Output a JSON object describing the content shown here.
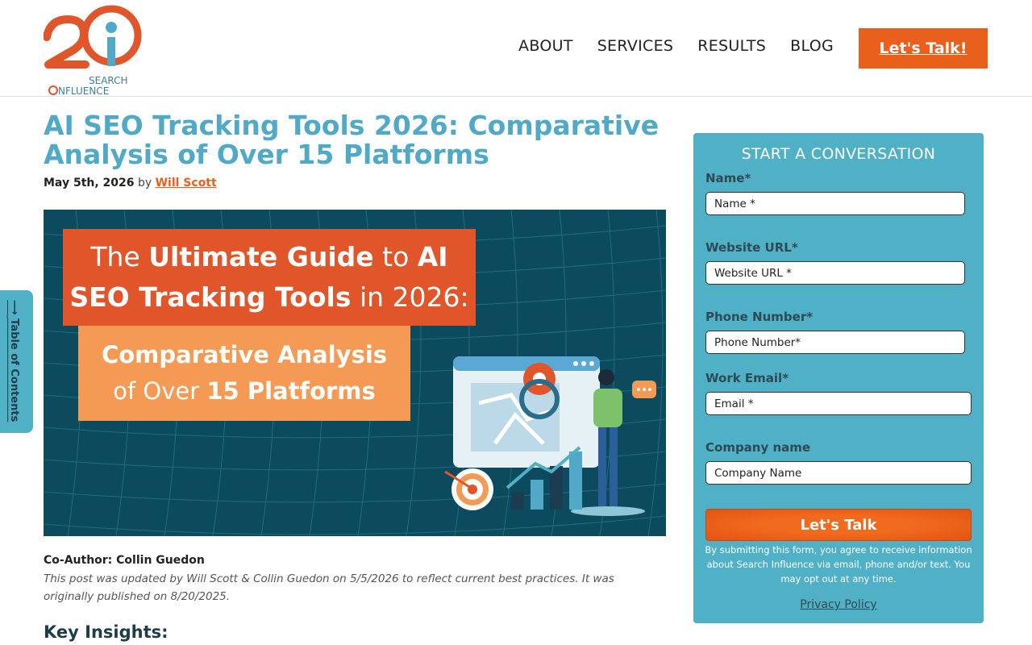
{
  "brand": {
    "logo_line1": "SEARCH",
    "logo_line2": "NFLUENCE"
  },
  "nav": {
    "items": [
      "ABOUT",
      "SERVICES",
      "RESULTS",
      "BLOG"
    ],
    "cta": "Let's Talk!"
  },
  "article": {
    "title": "AI SEO Tracking Tools 2026: Comparative Analysis of Over 15 Platforms",
    "date": "May 5th, 2026",
    "by": "by",
    "author": "Will Scott",
    "hero": {
      "line1_plain": "The ",
      "line1_bold": "Ultimate Guide",
      "line1_plain2": " to ",
      "line1_bold2": "AI",
      "line2_bold": "SEO Tracking Tools",
      "line2_plain": " in 2026:",
      "line3_bold": "Comparative Analysis",
      "line4_plain": "of Over ",
      "line4_bold": "15 Platforms"
    },
    "coauthor": "Co-Author: Collin Guedon",
    "update_note": "This post was updated by Will Scott & Collin Guedon on 5/5/2026 to reflect current best practices. It was originally published on 8/20/2025.",
    "section_heading": "Key Insights:"
  },
  "toc": {
    "label": "Table of Contents",
    "arrow": "⟶"
  },
  "form": {
    "title": "START A CONVERSATION",
    "fields": [
      {
        "label": "Name*",
        "placeholder": "Name *"
      },
      {
        "label": "Website URL*",
        "placeholder": "Website URL *"
      },
      {
        "label": "Phone Number*",
        "placeholder": "Phone Number*"
      },
      {
        "label": "Work Email*",
        "placeholder": "Email *"
      },
      {
        "label": "Company name",
        "placeholder": "Company Name"
      }
    ],
    "submit": "Let's Talk",
    "disclaimer": "By submitting this form, you agree to receive information about Search Influence via email, phone and/or text. You may opt out at any time.",
    "privacy": "Privacy Policy"
  },
  "colors": {
    "accent_orange": "#e8601c",
    "accent_blue": "#4fa9c7",
    "form_bg": "#4fb0c6"
  }
}
